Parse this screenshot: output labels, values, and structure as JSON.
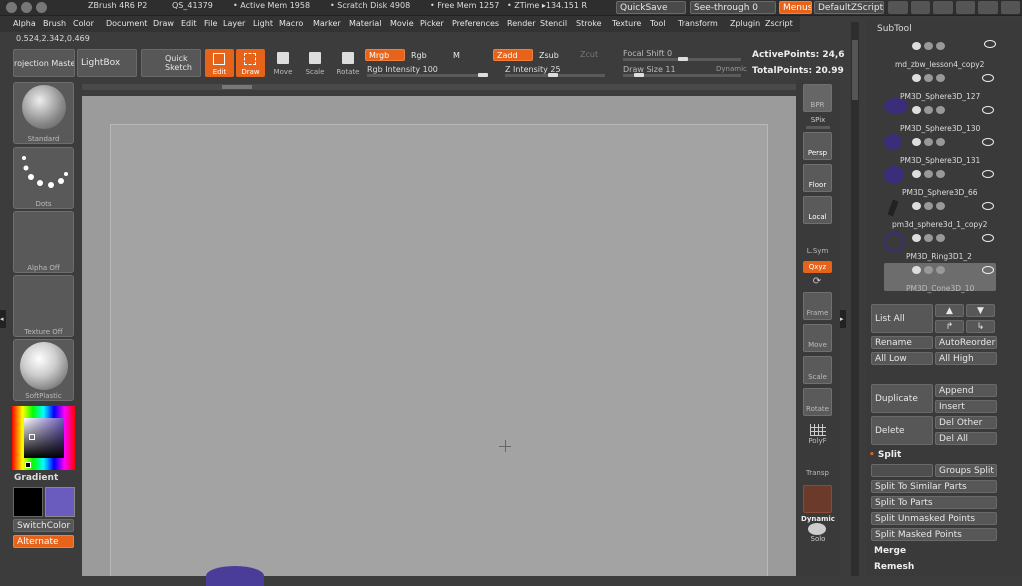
{
  "titlebar": {
    "app": "ZBrush 4R6 P2",
    "doc": "QS_41379",
    "mem": "• Active Mem 1958",
    "scratch": "• Scratch Disk 4908",
    "free": "• Free Mem 1257",
    "ztime": "• ZTime ▸134.151 R",
    "quicksave": "QuickSave",
    "seethrough": "See-through 0",
    "menus": "Menus",
    "defaultscript": "DefaultZScript"
  },
  "menubar": [
    "Alpha",
    "Brush",
    "Color",
    "Document",
    "Draw",
    "Edit",
    "File",
    "Layer",
    "Light",
    "Macro",
    "Marker",
    "Material",
    "Movie",
    "Picker",
    "Preferences",
    "Render",
    "Stencil",
    "Stroke",
    "Texture",
    "Tool",
    "Transform",
    "Zplugin",
    "Zscript"
  ],
  "coords": "0.524,2.342,0.469",
  "toolbar": {
    "projection": "Projection Master",
    "lightbox": "LightBox",
    "quicksketch": "Quick Sketch",
    "edit": "Edit",
    "draw": "Draw",
    "move": "Move",
    "scale": "Scale",
    "rotate": "Rotate",
    "mrgb": "Mrgb",
    "rgb": "Rgb",
    "m": "M",
    "zadd": "Zadd",
    "zsub": "Zsub",
    "zcut": "Zcut",
    "rgb_intensity": "Rgb Intensity 100",
    "z_intensity": "Z Intensity 25",
    "focal_shift": "Focal Shift 0",
    "draw_size": "Draw Size 11",
    "dynamic": "Dynamic",
    "active_points": "ActivePoints: 24,6",
    "total_points": "TotalPoints: 20.99"
  },
  "leftshelf": {
    "standard": "Standard",
    "dots": "Dots",
    "alpha_off": "Alpha Off",
    "texture_off": "Texture Off",
    "softplastic": "SoftPlastic",
    "gradient": "Gradient",
    "switchcolor": "SwitchColor",
    "alternate": "Alternate"
  },
  "rightshelf": [
    "BPR",
    "SPix",
    "Persp",
    "Floor",
    "Local",
    "L.Sym",
    "Qxyz",
    "Frame",
    "Move",
    "Scale",
    "Rotate",
    "PolyF",
    "Transp",
    "Dynamic",
    "Solo"
  ],
  "subtool": {
    "title": "SubTool",
    "items": [
      "md_zbw_lesson4_copy2",
      "PM3D_Sphere3D_127",
      "PM3D_Sphere3D_130",
      "PM3D_Sphere3D_131",
      "PM3D_Sphere3D_66",
      "pm3d_sphere3d_1_copy2",
      "PM3D_Ring3D1_2",
      "PM3D_Cone3D_10"
    ],
    "list_all": "List All",
    "rename": "Rename",
    "autoreorder": "AutoReorder",
    "all_low": "All Low",
    "all_high": "All High",
    "duplicate": "Duplicate",
    "append": "Append",
    "insert": "Insert",
    "delete": "Delete",
    "del_other": "Del Other",
    "del_all": "Del All",
    "split": "Split",
    "groups_split": "Groups Split",
    "split_similar": "Split To Similar Parts",
    "split_parts": "Split To Parts",
    "split_unmasked": "Split Unmasked Points",
    "split_masked": "Split Masked Points",
    "merge": "Merge",
    "remesh": "Remesh"
  },
  "colors": {
    "accent": "#e8631a",
    "secondary": "#6a5bbf"
  }
}
